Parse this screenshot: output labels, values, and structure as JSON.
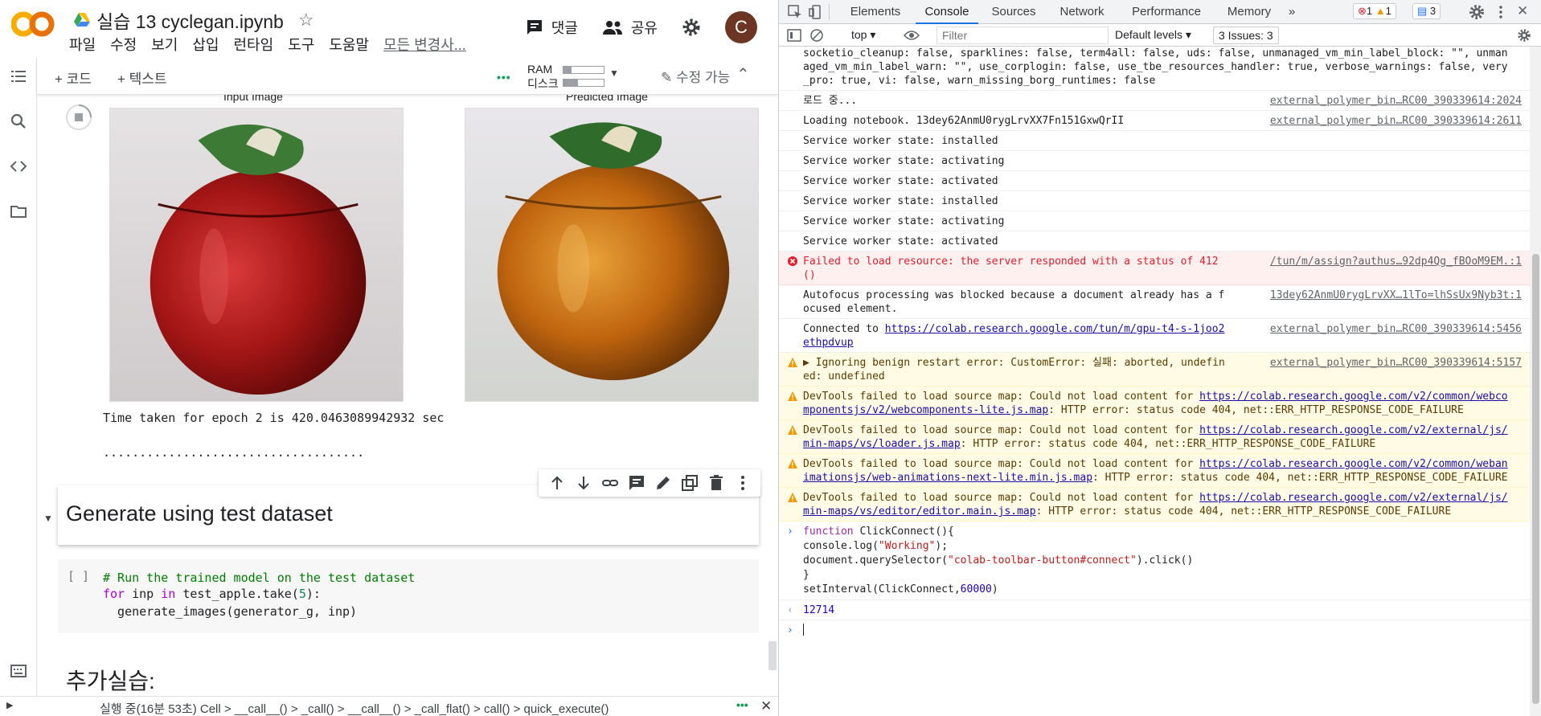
{
  "colab": {
    "notebook_title": "실습 13 cyclegan.ipynb",
    "menu": [
      "파일",
      "수정",
      "보기",
      "삽입",
      "런타임",
      "도구",
      "도움말",
      "모든 변경사..."
    ],
    "comment_label": "댓글",
    "share_label": "공유",
    "avatar_letter": "C",
    "toolbar": {
      "add_code": "+ 코드",
      "add_text": "+ 텍스트",
      "ram_label": "RAM",
      "disk_label": "디스크",
      "ram_usage": 0.2,
      "disk_usage": 0.35,
      "edit_label": "수정 가능"
    },
    "output": {
      "input_caption": "Input Image",
      "predicted_caption": "Predicted Image",
      "epoch_text": "Time taken for epoch 2 is 420.0463089942932 sec",
      "progress_dots": "...................................."
    },
    "markdown_title": "Generate using test dataset",
    "code_cell": {
      "exec_count": "[ ]",
      "line1": "# Run the trained model on the test dataset",
      "line2_kw1": "for",
      "line2_var": " inp ",
      "line2_kw2": "in",
      "line2_rest": " test_apple.take(",
      "line2_num": "5",
      "line2_end": "):",
      "line3": "  generate_images(generator_g, inp)"
    },
    "next_heading": "추가실습:",
    "status": {
      "text": "실행 중(16분 53초)  Cell > __call__() > _call() > __call__() > _call_flat() > call() > quick_execute()"
    }
  },
  "devtools": {
    "tabs": [
      "Elements",
      "Console",
      "Sources",
      "Network",
      "Performance",
      "Memory",
      "»"
    ],
    "active_tab": "Console",
    "error_count": "1",
    "warn_count": "1",
    "info_count": "3",
    "context": "top ▾",
    "filter_placeholder": "Filter",
    "levels": "Default levels ▾",
    "issues": "3 Issues:  3",
    "messages": [
      {
        "type": "log",
        "text": "socketio_cleanup: false, sparklines: false, term4all: false, uds: false, unmanaged_vm_min_label_block: \"\", unmanaged_vm_min_label_warn: \"\", use_corplogin: false, use_tbe_resources_handler: true, verbose_warnings: false, very_pro: true, vi: false, warn_missing_borg_runtimes: false",
        "src": ""
      },
      {
        "type": "log",
        "text": "로드 중...",
        "src": "external_polymer_bin…RC00_390339614:2024"
      },
      {
        "type": "log",
        "text": "Loading notebook. 13dey62AnmU0rygLrvXX7Fn151GxwQrII",
        "src": "external_polymer_bin…RC00_390339614:2611"
      },
      {
        "type": "log",
        "text": "Service worker state: installed",
        "src": ""
      },
      {
        "type": "log",
        "text": "Service worker state: activating",
        "src": ""
      },
      {
        "type": "log",
        "text": "Service worker state: activated",
        "src": ""
      },
      {
        "type": "log",
        "text": "Service worker state: installed",
        "src": ""
      },
      {
        "type": "log",
        "text": "Service worker state: activating",
        "src": ""
      },
      {
        "type": "log",
        "text": "Service worker state: activated",
        "src": ""
      },
      {
        "type": "err",
        "text": "Failed to load resource: the server responded with a status of 412 ()",
        "src": "/tun/m/assign?authus…92dp4Qg_fBOoM9EM.:1"
      },
      {
        "type": "log",
        "text": "Autofocus processing was blocked because a document already has a focused element.",
        "src": "13dey62AnmU0rygLrvXX…1lTo=lhSsUx9Nyb3t:1"
      },
      {
        "type": "log",
        "text": "Connected to ",
        "link": "https://colab.research.google.com/tun/m/gpu-t4-s-1joo2ethpdvup",
        "src": "external_polymer_bin…RC00_390339614:5456"
      },
      {
        "type": "warn",
        "text": "▶ Ignoring benign restart error: CustomError: 실패: aborted, undefined: undefined",
        "src": "external_polymer_bin…RC00_390339614:5157"
      },
      {
        "type": "warn-wide",
        "pre": "DevTools failed to load source map: Could not load content for ",
        "link": "https://colab.research.google.com/v2/common/webcomponentsjs/v2/webcomponents-lite.js.map",
        "post": ": HTTP error: status code 404, net::ERR_HTTP_RESPONSE_CODE_FAILURE"
      },
      {
        "type": "warn-wide",
        "pre": "DevTools failed to load source map: Could not load content for ",
        "link": "https://colab.research.google.com/v2/external/js/min-maps/vs/loader.js.map",
        "post": ": HTTP error: status code 404, net::ERR_HTTP_RESPONSE_CODE_FAILURE"
      },
      {
        "type": "warn-wide",
        "pre": "DevTools failed to load source map: Could not load content for ",
        "link": "https://colab.research.google.com/v2/common/webanimationsjs/web-animations-next-lite.min.js.map",
        "post": ": HTTP error: status code 404, net::ERR_HTTP_RESPONSE_CODE_FAILURE"
      },
      {
        "type": "warn-wide",
        "pre": "DevTools failed to load source map: Could not load content for ",
        "link": "https://colab.research.google.com/v2/external/js/min-maps/vs/editor/editor.main.js.map",
        "post": ": HTTP error: status code 404, net::ERR_HTTP_RESPONSE_CODE_FAILURE"
      }
    ],
    "input_code": {
      "l1_kw": "function",
      "l1_rest": " ClickConnect(){",
      "l2_pre": "console.log(",
      "l2_str": "\"Working\"",
      "l2_post": ");",
      "l3_pre": "document.querySelector(",
      "l3_str": "\"colab-toolbar-button#connect\"",
      "l3_post": ").click()",
      "l4": "}",
      "l5_pre": "setInterval(ClickConnect,",
      "l5_num": "60000",
      "l5_post": ")"
    },
    "result_value": "12714"
  },
  "colors": {
    "accent": "#1a73e8",
    "error": "#e41e2b",
    "warn_bg": "#fffbe5",
    "colab_orange": "#f9ab00"
  }
}
